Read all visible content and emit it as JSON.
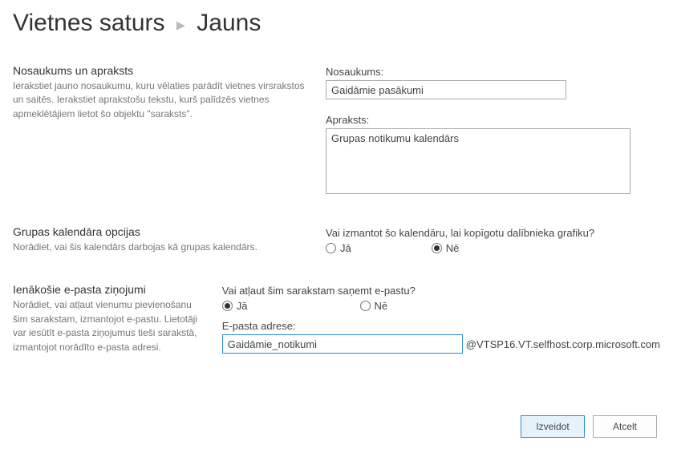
{
  "breadcrumb": {
    "parent": "Vietnes saturs",
    "current": "Jauns"
  },
  "section1": {
    "title": "Nosaukums un apraksts",
    "desc": "Ierakstiet jauno nosaukumu, kuru vēlaties parādīt vietnes virsrakstos un saitēs. Ierakstiet aprakstošu tekstu, kurš palīdzēs vietnes apmeklētājiem lietot šo objektu \"saraksts\".",
    "name_label": "Nosaukums:",
    "name_value": "Gaidāmie pasākumi",
    "desc_label": "Apraksts:",
    "desc_value": "Grupas notikumu kalendārs"
  },
  "section2": {
    "title": "Grupas kalendāra opcijas",
    "desc": "Norādiet, vai šis kalendārs darbojas kā grupas kalendārs.",
    "question": "Vai izmantot šo kalendāru, lai kopīgotu dalībnieka grafiku?",
    "yes": "Jā",
    "no": "Nē",
    "selected": "no"
  },
  "section3": {
    "title": "Ienākošie e-pasta ziņojumi",
    "desc": "Norādiet, vai atļaut vienumu pievienošanu šim sarakstam, izmantojot e-pastu. Lietotāji var iesūtīt e-pasta ziņojumus tieši sarakstā, izmantojot norādīto e-pasta adresi.",
    "question": "Vai atļaut šim sarakstam saņemt e-pastu?",
    "yes": "Jā",
    "no": "Nē",
    "selected": "yes",
    "email_label": "E-pasta adrese:",
    "email_value": "Gaidāmie_notikumi",
    "email_domain": "@VTSP16.VT.selfhost.corp.microsoft.com"
  },
  "buttons": {
    "create": "Izveidot",
    "cancel": "Atcelt"
  }
}
